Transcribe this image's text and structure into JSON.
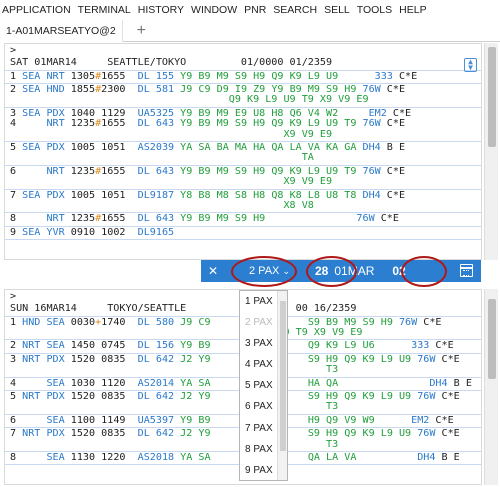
{
  "menu": [
    "APPLICATION",
    "TERMINAL",
    "HISTORY",
    "WINDOW",
    "PNR",
    "SEARCH",
    "SELL",
    "TOOLS",
    "HELP"
  ],
  "tabs": [
    {
      "label": "1-A01MARSEATYO@2"
    }
  ],
  "pane1": {
    "prompt": ">",
    "header": "SAT 01MAR14     SEATTLE/TOKYO         01/0000 01/2359",
    "rows": [
      {
        "lines": [
          [
            [
              "dark",
              "1 "
            ],
            [
              "blue",
              "SEA NRT"
            ],
            [
              "dark",
              " 1305"
            ],
            [
              "orange",
              "#"
            ],
            [
              "dark",
              "1655  "
            ],
            [
              "blue",
              "DL 155"
            ],
            [
              "green",
              " Y9 B9 M9 S9 H9 Q9 K9 L9 U9      "
            ],
            [
              "blue",
              "333"
            ],
            [
              "dark",
              " C*E"
            ]
          ]
        ]
      },
      {
        "lines": [
          [
            [
              "dark",
              "2 "
            ],
            [
              "blue",
              "SEA HND"
            ],
            [
              "dark",
              " 1855"
            ],
            [
              "orange",
              "#"
            ],
            [
              "dark",
              "2300  "
            ],
            [
              "blue",
              "DL 581"
            ],
            [
              "green",
              " J9 C9 D9 I9 Z9 Y9 B9 M9 S9 H9 "
            ],
            [
              "blue",
              "76W"
            ],
            [
              "dark",
              " C*E"
            ]
          ],
          [
            [
              "green",
              "                                    Q9 K9 L9 U9 T9 X9 V9 E9"
            ]
          ]
        ]
      },
      {
        "lines": [
          [
            [
              "dark",
              "3 "
            ],
            [
              "blue",
              "SEA PDX"
            ],
            [
              "dark",
              " 1040 1129  "
            ],
            [
              "blue",
              "UA5325"
            ],
            [
              "green",
              " Y9 B9 M9 E9 U8 H8 Q6 V4 W2     "
            ],
            [
              "blue",
              "EM2"
            ],
            [
              "dark",
              " C*E"
            ]
          ],
          [
            [
              "dark",
              "4     "
            ],
            [
              "blue",
              "NRT"
            ],
            [
              "dark",
              " 1235"
            ],
            [
              "orange",
              "#"
            ],
            [
              "dark",
              "1655  "
            ],
            [
              "blue",
              "DL 643"
            ],
            [
              "green",
              " Y9 B9 M9 S9 H9 Q9 K9 L9 U9 T9 "
            ],
            [
              "blue",
              "76W"
            ],
            [
              "dark",
              " C*E"
            ]
          ],
          [
            [
              "green",
              "                                             X9 V9 E9"
            ]
          ]
        ]
      },
      {
        "lines": [
          [
            [
              "dark",
              "5 "
            ],
            [
              "blue",
              "SEA PDX"
            ],
            [
              "dark",
              " 1005 1051  "
            ],
            [
              "blue",
              "AS2039"
            ],
            [
              "green",
              " YA SA BA MA HA QA LA VA KA GA "
            ],
            [
              "blue",
              "DH4"
            ],
            [
              "dark",
              " B E"
            ]
          ],
          [
            [
              "green",
              "                                                TA"
            ]
          ]
        ]
      },
      {
        "lines": [
          [
            [
              "dark",
              "6     "
            ],
            [
              "blue",
              "NRT"
            ],
            [
              "dark",
              " 1235"
            ],
            [
              "orange",
              "#"
            ],
            [
              "dark",
              "1655  "
            ],
            [
              "blue",
              "DL 643"
            ],
            [
              "green",
              " Y9 B9 M9 S9 H9 Q9 K9 L9 U9 T9 "
            ],
            [
              "blue",
              "76W"
            ],
            [
              "dark",
              " C*E"
            ]
          ],
          [
            [
              "green",
              "                                             X9 V9 E9"
            ]
          ]
        ]
      },
      {
        "lines": [
          [
            [
              "dark",
              "7 "
            ],
            [
              "blue",
              "SEA PDX"
            ],
            [
              "dark",
              " 1005 1051  "
            ],
            [
              "blue",
              "DL9187"
            ],
            [
              "green",
              " Y8 B8 M8 S8 H8 Q8 K8 L8 U8 T8 "
            ],
            [
              "blue",
              "DH4"
            ],
            [
              "dark",
              " C*E"
            ]
          ],
          [
            [
              "green",
              "                                             X8 V8"
            ]
          ]
        ]
      },
      {
        "lines": [
          [
            [
              "dark",
              "8     "
            ],
            [
              "blue",
              "NRT"
            ],
            [
              "dark",
              " 1235"
            ],
            [
              "orange",
              "#"
            ],
            [
              "dark",
              "1655  "
            ],
            [
              "blue",
              "DL 643"
            ],
            [
              "green",
              " Y9 B9 M9 S9 H9               "
            ],
            [
              "blue",
              "76W"
            ],
            [
              "dark",
              " C*E"
            ]
          ]
        ]
      },
      {
        "lines": [
          [
            [
              "dark",
              "9 "
            ],
            [
              "blue",
              "SEA YVR"
            ],
            [
              "dark",
              " 0910 1002  "
            ],
            [
              "blue",
              "DL9165"
            ]
          ]
        ]
      }
    ]
  },
  "toolbar": {
    "close": "✕",
    "pax": "2 PAX",
    "pax_arrow": "⌄",
    "day": "28",
    "month": "01MAR",
    "number": "02"
  },
  "pane2": {
    "prompt": ">",
    "header": "SUN 16MAR14     TOKYO/SEATTLE",
    "header_tail": "00 16/2359",
    "rows": [
      {
        "lines": [
          [
            [
              "dark",
              "1 "
            ],
            [
              "blue",
              "HND SEA"
            ],
            [
              "dark",
              " 0030"
            ],
            [
              "orange",
              "+"
            ],
            [
              "dark",
              "1740  "
            ],
            [
              "blue",
              "DL 580"
            ],
            [
              "green",
              " J9 C9"
            ],
            [
              "dark",
              "                "
            ],
            [
              "green",
              "S9 B9 M9 S9 H9 "
            ],
            [
              "blue",
              "76W"
            ],
            [
              "dark",
              " C*E"
            ]
          ],
          [
            [
              "green",
              "                                         L9 U9 T9 X9 V9 E9"
            ]
          ]
        ]
      },
      {
        "lines": [
          [
            [
              "dark",
              "2 "
            ],
            [
              "blue",
              "NRT SEA"
            ],
            [
              "dark",
              " 1450 0745  "
            ],
            [
              "blue",
              "DL 156"
            ],
            [
              "green",
              " Y9 B9"
            ],
            [
              "dark",
              "                "
            ],
            [
              "green",
              "Q9 K9 L9 U6      "
            ],
            [
              "blue",
              "333"
            ],
            [
              "dark",
              " C*E"
            ]
          ]
        ]
      },
      {
        "lines": [
          [
            [
              "dark",
              "3 "
            ],
            [
              "blue",
              "NRT PDX"
            ],
            [
              "dark",
              " 1520 0835  "
            ],
            [
              "blue",
              "DL 642"
            ],
            [
              "green",
              " J2 Y9"
            ],
            [
              "dark",
              "                "
            ],
            [
              "green",
              "S9 H9 Q9 K9 L9 U9 "
            ],
            [
              "blue",
              "76W"
            ],
            [
              "dark",
              " C*E"
            ]
          ],
          [
            [
              "green",
              "                                                    T3"
            ]
          ]
        ]
      },
      {
        "lines": [
          [
            [
              "dark",
              "4     "
            ],
            [
              "blue",
              "SEA"
            ],
            [
              "dark",
              " 1030 1120  "
            ],
            [
              "blue",
              "AS2014"
            ],
            [
              "green",
              " YA SA"
            ],
            [
              "dark",
              "                "
            ],
            [
              "green",
              "HA QA"
            ],
            [
              "dark",
              "               "
            ],
            [
              "blue",
              "DH4"
            ],
            [
              "dark",
              " B E"
            ]
          ]
        ]
      },
      {
        "lines": [
          [
            [
              "dark",
              "5 "
            ],
            [
              "blue",
              "NRT PDX"
            ],
            [
              "dark",
              " 1520 0835  "
            ],
            [
              "blue",
              "DL 642"
            ],
            [
              "green",
              " J2 Y9"
            ],
            [
              "dark",
              "                "
            ],
            [
              "green",
              "S9 H9 Q9 K9 L9 U9 "
            ],
            [
              "blue",
              "76W"
            ],
            [
              "dark",
              " C*E"
            ]
          ],
          [
            [
              "green",
              "                                                    T3"
            ]
          ]
        ]
      },
      {
        "lines": [
          [
            [
              "dark",
              "6     "
            ],
            [
              "blue",
              "SEA"
            ],
            [
              "dark",
              " 1100 1149  "
            ],
            [
              "blue",
              "UA5397"
            ],
            [
              "green",
              " Y9 B9"
            ],
            [
              "dark",
              "                "
            ],
            [
              "green",
              "H9 Q9 V9 W9      "
            ],
            [
              "blue",
              "EM2"
            ],
            [
              "dark",
              " C*E"
            ]
          ]
        ]
      },
      {
        "lines": [
          [
            [
              "dark",
              "7 "
            ],
            [
              "blue",
              "NRT PDX"
            ],
            [
              "dark",
              " 1520 0835  "
            ],
            [
              "blue",
              "DL 642"
            ],
            [
              "green",
              " J2 Y9"
            ],
            [
              "dark",
              "                "
            ],
            [
              "green",
              "S9 H9 Q9 K9 L9 U9 "
            ],
            [
              "blue",
              "76W"
            ],
            [
              "dark",
              " C*E"
            ]
          ],
          [
            [
              "green",
              "                                                    T3"
            ]
          ]
        ]
      },
      {
        "lines": [
          [
            [
              "dark",
              "8     "
            ],
            [
              "blue",
              "SEA"
            ],
            [
              "dark",
              " 1130 1220  "
            ],
            [
              "blue",
              "AS2018"
            ],
            [
              "green",
              " YA SA"
            ],
            [
              "dark",
              "                "
            ],
            [
              "green",
              "QA LA VA"
            ],
            [
              "dark",
              "          "
            ],
            [
              "blue",
              "DH4"
            ],
            [
              "dark",
              " B E"
            ]
          ]
        ]
      }
    ]
  },
  "pax_options": [
    "1 PAX",
    "2 PAX",
    "3 PAX",
    "4 PAX",
    "5 PAX",
    "6 PAX",
    "7 PAX",
    "8 PAX",
    "9 PAX"
  ],
  "pax_selected": "2 PAX",
  "colors": {
    "accent": "#2c7fd0",
    "flight_blue": "#2a79c9",
    "class_green": "#1f9e3a",
    "arrival_marker": "#e08a1a",
    "annotation_red": "#b01818"
  }
}
